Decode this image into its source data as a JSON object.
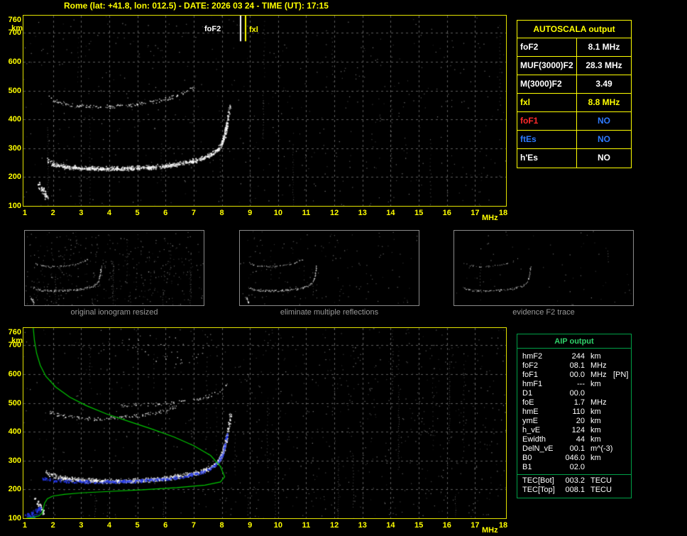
{
  "header": {
    "title": "Rome (lat: +41.8, lon: 012.5) - DATE: 2026 03 24 - TIME (UT): 17:15"
  },
  "axes": {
    "x_range": [
      0.95,
      18.1
    ],
    "y_range": [
      100,
      760
    ],
    "x_ticks": [
      1,
      2,
      3,
      4,
      5,
      6,
      7,
      8,
      9,
      10,
      11,
      12,
      13,
      14,
      15,
      16,
      17,
      18
    ],
    "y_ticks": [
      760,
      700,
      600,
      500,
      400,
      300,
      200,
      100
    ],
    "x_unit": "MHz",
    "y_unit": "km"
  },
  "main_markers": {
    "foF2_label": "foF2",
    "fxl_label": "fxl"
  },
  "autoscala": {
    "title": "AUTOSCALA output",
    "rows": [
      {
        "label": "foF2",
        "value": "8.1 MHz",
        "label_color": "#ffffff",
        "value_color": "#ffffff"
      },
      {
        "label": "MUF(3000)F2",
        "value": "28.3 MHz",
        "label_color": "#ffffff",
        "value_color": "#ffffff"
      },
      {
        "label": "M(3000)F2",
        "value": "3.49",
        "label_color": "#ffffff",
        "value_color": "#ffffff"
      },
      {
        "label": "fxl",
        "value": "8.8 MHz",
        "label_color": "#ffff00",
        "value_color": "#ffff00"
      },
      {
        "label": "foF1",
        "value": "NO",
        "label_color": "#ff2a2a",
        "value_color": "#2e7bff"
      },
      {
        "label": "ftEs",
        "value": "NO",
        "label_color": "#2e7bff",
        "value_color": "#2e7bff"
      },
      {
        "label": "h'Es",
        "value": "NO",
        "label_color": "#ffffff",
        "value_color": "#ffffff"
      }
    ]
  },
  "thumbnails": [
    {
      "caption": "original ionogram resized"
    },
    {
      "caption": "eliminate multiple reflections"
    },
    {
      "caption": "evidence F2 trace"
    }
  ],
  "aip": {
    "title": "AIP output",
    "rows": [
      {
        "label": "hmF2",
        "value": "244",
        "unit": "km",
        "extra": ""
      },
      {
        "label": "foF2",
        "value": "08.1",
        "unit": "MHz",
        "extra": ""
      },
      {
        "label": "foF1",
        "value": "00.0",
        "unit": "MHz",
        "extra": "[PN]"
      },
      {
        "label": "hmF1",
        "value": "---",
        "unit": "km",
        "extra": ""
      },
      {
        "label": "D1",
        "value": "00.0",
        "unit": "",
        "extra": ""
      },
      {
        "label": "foE",
        "value": "1.7",
        "unit": "MHz",
        "extra": ""
      },
      {
        "label": "hmE",
        "value": "110",
        "unit": "km",
        "extra": ""
      },
      {
        "label": "ymE",
        "value": "20",
        "unit": "km",
        "extra": ""
      },
      {
        "label": "h_vE",
        "value": "124",
        "unit": "km",
        "extra": ""
      },
      {
        "label": "Ewidth",
        "value": "44",
        "unit": "km",
        "extra": ""
      },
      {
        "label": "DelN_vE",
        "value": "00.1",
        "unit": "m^(-3)",
        "extra": ""
      },
      {
        "label": "B0",
        "value": "046.0",
        "unit": "km",
        "extra": ""
      },
      {
        "label": "B1",
        "value": "02.0",
        "unit": "",
        "extra": ""
      }
    ],
    "tec_rows": [
      {
        "label": "TEC[Bot]",
        "value": "003.2",
        "unit": "TECU",
        "extra": ""
      },
      {
        "label": "TEC[Top]",
        "value": "008.1",
        "unit": "TECU",
        "extra": ""
      }
    ]
  },
  "colors": {
    "accent_yellow": "#ffff00",
    "frame_yellow": "#e2e200",
    "aip_green": "#00a048",
    "profile_green": "#00c800",
    "trace_blue": "#2438e8",
    "grid_gray": "#5c5c5c",
    "caption_gray": "#999999"
  },
  "trace_library": {
    "f2_main": {
      "color": "#ffffff",
      "size": 1.6,
      "spread": 7,
      "density": 1.5,
      "points": [
        [
          1.75,
          260
        ],
        [
          2.0,
          246
        ],
        [
          2.4,
          237
        ],
        [
          3.0,
          232
        ],
        [
          3.8,
          230
        ],
        [
          4.6,
          231
        ],
        [
          5.3,
          234
        ],
        [
          6.0,
          240
        ],
        [
          6.6,
          249
        ],
        [
          7.1,
          260
        ],
        [
          7.5,
          274
        ],
        [
          7.8,
          292
        ],
        [
          8.0,
          318
        ],
        [
          8.12,
          355
        ],
        [
          8.2,
          400
        ],
        [
          8.27,
          452
        ]
      ]
    },
    "f2_core": {
      "color": "#ffffff",
      "size": 2,
      "spread": 3,
      "density": 1.2,
      "points": [
        [
          2.0,
          244
        ],
        [
          2.6,
          235
        ],
        [
          3.4,
          230
        ],
        [
          4.4,
          230
        ],
        [
          5.2,
          233
        ],
        [
          5.9,
          238
        ],
        [
          6.5,
          246
        ],
        [
          7.0,
          257
        ],
        [
          7.45,
          271
        ],
        [
          7.75,
          288
        ],
        [
          7.95,
          310
        ],
        [
          8.08,
          345
        ],
        [
          8.17,
          390
        ]
      ]
    },
    "second_hop": {
      "color": "#ffffff",
      "size": 1.4,
      "spread": 5,
      "density": 0.8,
      "points": [
        [
          1.85,
          478
        ],
        [
          2.2,
          460
        ],
        [
          2.7,
          450
        ],
        [
          3.4,
          445
        ],
        [
          4.1,
          446
        ],
        [
          4.8,
          451
        ],
        [
          5.4,
          459
        ],
        [
          5.9,
          469
        ],
        [
          6.4,
          483
        ],
        [
          6.8,
          500
        ],
        [
          7.0,
          512
        ]
      ]
    },
    "e_blob": {
      "color": "#ffffff",
      "size": 2,
      "spread": 9,
      "density": 1.6,
      "points": [
        [
          1.45,
          178
        ],
        [
          1.6,
          158
        ],
        [
          1.7,
          140
        ],
        [
          1.78,
          122
        ]
      ]
    },
    "f2_main_b": {
      "color": "#ffffff",
      "size": 1.6,
      "spread": 7,
      "density": 1.6,
      "points": [
        [
          1.7,
          262
        ],
        [
          2.0,
          248
        ],
        [
          2.5,
          238
        ],
        [
          3.2,
          232
        ],
        [
          4.0,
          230
        ],
        [
          4.8,
          232
        ],
        [
          5.6,
          236
        ],
        [
          6.3,
          244
        ],
        [
          6.9,
          254
        ],
        [
          7.4,
          268
        ],
        [
          7.75,
          287
        ],
        [
          7.95,
          310
        ],
        [
          8.1,
          350
        ],
        [
          8.2,
          400
        ],
        [
          8.3,
          458
        ]
      ]
    },
    "f2_core_b": {
      "color": "#ffffff",
      "size": 2,
      "spread": 3,
      "density": 1.2,
      "points": [
        [
          2.2,
          242
        ],
        [
          3.0,
          233
        ],
        [
          4.0,
          229
        ],
        [
          5.0,
          232
        ],
        [
          5.9,
          238
        ],
        [
          6.6,
          248
        ],
        [
          7.2,
          261
        ],
        [
          7.6,
          278
        ],
        [
          7.85,
          298
        ],
        [
          8.02,
          330
        ],
        [
          8.13,
          370
        ]
      ]
    },
    "second_hop_b": {
      "color": "#ffffff",
      "size": 1.4,
      "spread": 5,
      "density": 0.7,
      "points": [
        [
          1.8,
          472
        ],
        [
          2.2,
          458
        ],
        [
          2.8,
          449
        ],
        [
          3.5,
          446
        ],
        [
          4.2,
          449
        ],
        [
          4.9,
          455
        ],
        [
          5.5,
          464
        ],
        [
          6.0,
          476
        ],
        [
          6.4,
          490
        ]
      ]
    },
    "band_500": {
      "color": "#ffffff",
      "size": 1.4,
      "spread": 5,
      "density": 0.45,
      "points": [
        [
          4.4,
          492
        ],
        [
          5.2,
          495
        ],
        [
          6.0,
          500
        ],
        [
          6.8,
          508
        ],
        [
          7.4,
          520
        ],
        [
          7.9,
          540
        ],
        [
          8.2,
          565
        ]
      ]
    },
    "top_cloud": {
      "color": "#e8e8e8",
      "size": 1.3,
      "spread": 45,
      "density": 0.3,
      "points": [
        [
          4.6,
          728
        ],
        [
          5.4,
          704
        ],
        [
          6.2,
          686
        ],
        [
          7.0,
          688
        ],
        [
          7.7,
          700
        ]
      ]
    },
    "e_blob_b": {
      "color": "#ffffff",
      "size": 2,
      "spread": 8,
      "density": 1.4,
      "points": [
        [
          1.35,
          168
        ],
        [
          1.5,
          148
        ],
        [
          1.6,
          130
        ],
        [
          1.65,
          115
        ]
      ]
    },
    "blue_trace": {
      "color": "#2438e8",
      "size": 2.2,
      "spread": 4,
      "density": 1.0,
      "points": [
        [
          1.55,
          240
        ],
        [
          2.0,
          234
        ],
        [
          2.6,
          230
        ],
        [
          3.4,
          227
        ],
        [
          4.2,
          228
        ],
        [
          5.0,
          231
        ],
        [
          5.8,
          236
        ],
        [
          6.5,
          244
        ],
        [
          7.0,
          254
        ],
        [
          7.45,
          267
        ],
        [
          7.78,
          286
        ],
        [
          7.97,
          312
        ],
        [
          8.1,
          352
        ],
        [
          8.17,
          398
        ]
      ]
    },
    "blue_blob": {
      "color": "#2438e8",
      "size": 2.3,
      "spread": 11,
      "density": 2.2,
      "points": [
        [
          1.02,
          106
        ],
        [
          1.2,
          112
        ],
        [
          1.4,
          122
        ],
        [
          1.52,
          135
        ]
      ]
    },
    "profile": {
      "line": true,
      "color": "#00c800",
      "lw": 1.2,
      "points": [
        [
          1.3,
          760
        ],
        [
          1.34,
          718
        ],
        [
          1.42,
          672
        ],
        [
          1.55,
          630
        ],
        [
          1.75,
          592
        ],
        [
          2.1,
          555
        ],
        [
          2.6,
          520
        ],
        [
          3.2,
          490
        ],
        [
          3.9,
          462
        ],
        [
          4.7,
          436
        ],
        [
          5.5,
          410
        ],
        [
          6.3,
          382
        ],
        [
          7.0,
          352
        ],
        [
          7.6,
          318
        ],
        [
          7.95,
          280
        ],
        [
          8.1,
          244
        ],
        [
          7.95,
          226
        ],
        [
          7.4,
          215
        ],
        [
          6.4,
          206
        ],
        [
          5.2,
          199
        ],
        [
          4.0,
          193
        ],
        [
          3.0,
          188
        ],
        [
          2.4,
          183
        ],
        [
          2.0,
          177
        ],
        [
          1.8,
          168
        ],
        [
          1.7,
          152
        ],
        [
          1.66,
          134
        ],
        [
          1.62,
          118
        ],
        [
          1.5,
          108
        ],
        [
          1.25,
          102
        ],
        [
          1.05,
          100
        ]
      ]
    }
  },
  "plots": {
    "main": {
      "seed": 7,
      "grid": true,
      "streaks": 14,
      "noise": [
        {
          "count": 520
        }
      ],
      "traces": [
        "f2_main",
        "f2_core",
        "second_hop",
        "e_blob"
      ],
      "vlines": [
        {
          "mhz": 8.66,
          "color": "#ffffff",
          "y_km": [
            671,
            760
          ]
        },
        {
          "mhz": 8.84,
          "color": "#ffff00",
          "y_km": [
            671,
            760
          ]
        }
      ]
    },
    "bottom": {
      "seed": 11,
      "grid": true,
      "streaks": 22,
      "noise": [
        {
          "count": 460
        },
        {
          "count": 320,
          "x": [
            8.5,
            18.1
          ]
        }
      ],
      "traces": [
        "f2_main_b",
        "f2_core_b",
        "second_hop_b",
        "band_500",
        "top_cloud",
        "e_blob_b",
        "blue_trace",
        "blue_blob",
        "profile"
      ]
    },
    "thumb1": {
      "seed": 21,
      "streaks": 18,
      "noise": [
        {
          "count": 380
        }
      ],
      "traces": [
        "f2_main",
        "second_hop",
        "e_blob"
      ]
    },
    "thumb2": {
      "seed": 22,
      "streaks": 5,
      "noise": [
        {
          "count": 150
        }
      ],
      "traces": [
        "f2_main",
        "second_hop",
        "e_blob"
      ]
    },
    "thumb3": {
      "seed": 23,
      "streaks": 2,
      "noise": [
        {
          "count": 60
        }
      ],
      "traces": [
        {
          "ref": "f2_main",
          "density": 1.0
        },
        {
          "ref": "second_hop",
          "density": 0.35
        }
      ]
    }
  }
}
